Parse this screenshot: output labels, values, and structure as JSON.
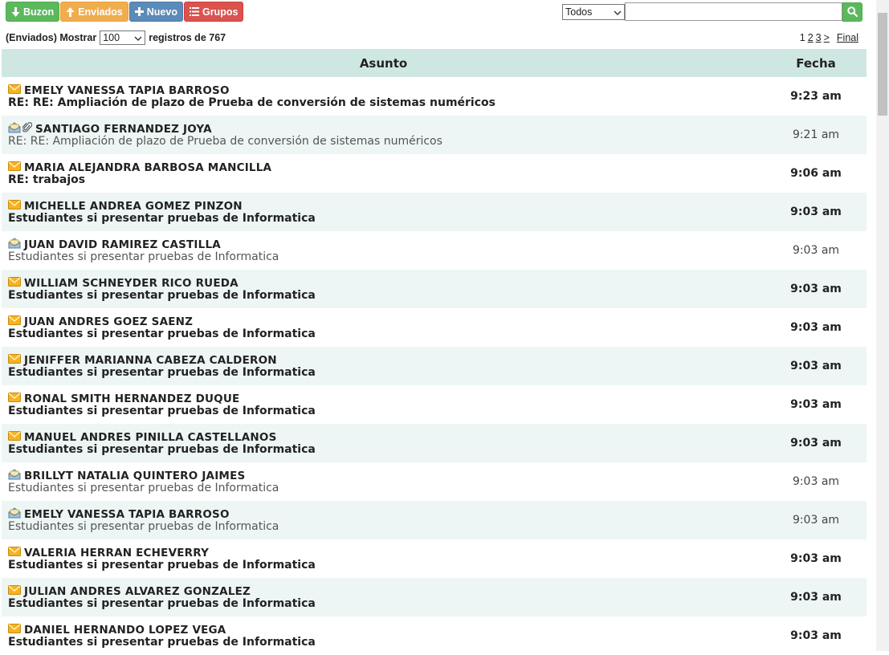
{
  "toolbar": {
    "buzon_label": "Buzon",
    "enviados_label": "Enviados",
    "nuevo_label": "Nuevo",
    "grupos_label": "Grupos"
  },
  "search": {
    "filter_value": "Todos",
    "query": ""
  },
  "listing": {
    "prefix": "(Enviados) Mostrar",
    "per_page": "100",
    "suffix": "registros de 767"
  },
  "pagination": {
    "pages": [
      "1",
      "2",
      "3",
      ">"
    ],
    "final_label": "Final"
  },
  "table": {
    "col_asunto": "Asunto",
    "col_fecha": "Fecha"
  },
  "messages": [
    {
      "name": "EMELY VANESSA TAPIA BARROSO",
      "subject": "RE: RE: Ampliación de plazo de Prueba de conversión de sistemas numéricos",
      "time": "9:23 am",
      "status": "unread",
      "icon": "envelope-icon",
      "attachment": false
    },
    {
      "name": "SANTIAGO FERNANDEZ JOYA",
      "subject": "RE: RE: Ampliación de plazo de Prueba de conversión de sistemas numéricos",
      "time": "9:21 am",
      "status": "read",
      "icon": "open-envelope-icon",
      "attachment": true
    },
    {
      "name": "MARIA ALEJANDRA BARBOSA MANCILLA",
      "subject": "RE: trabajos",
      "time": "9:06 am",
      "status": "unread",
      "icon": "envelope-icon",
      "attachment": false
    },
    {
      "name": "MICHELLE ANDREA GOMEZ PINZON",
      "subject": "Estudiantes si presentar pruebas de Informatica",
      "time": "9:03 am",
      "status": "unread",
      "icon": "envelope-icon",
      "attachment": false
    },
    {
      "name": "JUAN DAVID RAMIREZ CASTILLA",
      "subject": "Estudiantes si presentar pruebas de Informatica",
      "time": "9:03 am",
      "status": "read",
      "icon": "open-envelope-icon",
      "attachment": false
    },
    {
      "name": "WILLIAM SCHNEYDER RICO RUEDA",
      "subject": "Estudiantes si presentar pruebas de Informatica",
      "time": "9:03 am",
      "status": "unread",
      "icon": "envelope-icon",
      "attachment": false
    },
    {
      "name": "JUAN ANDRES GOEZ SAENZ",
      "subject": "Estudiantes si presentar pruebas de Informatica",
      "time": "9:03 am",
      "status": "unread",
      "icon": "envelope-icon",
      "attachment": false
    },
    {
      "name": "JENIFFER MARIANNA CABEZA CALDERON",
      "subject": "Estudiantes si presentar pruebas de Informatica",
      "time": "9:03 am",
      "status": "unread",
      "icon": "envelope-icon",
      "attachment": false
    },
    {
      "name": "RONAL SMITH HERNANDEZ DUQUE",
      "subject": "Estudiantes si presentar pruebas de Informatica",
      "time": "9:03 am",
      "status": "unread",
      "icon": "envelope-icon",
      "attachment": false
    },
    {
      "name": "MANUEL ANDRES PINILLA CASTELLANOS",
      "subject": "Estudiantes si presentar pruebas de Informatica",
      "time": "9:03 am",
      "status": "unread",
      "icon": "envelope-icon",
      "attachment": false
    },
    {
      "name": "BRILLYT NATALIA QUINTERO JAIMES",
      "subject": "Estudiantes si presentar pruebas de Informatica",
      "time": "9:03 am",
      "status": "read",
      "icon": "open-envelope-icon",
      "attachment": false
    },
    {
      "name": "EMELY VANESSA TAPIA BARROSO",
      "subject": "Estudiantes si presentar pruebas de Informatica",
      "time": "9:03 am",
      "status": "read",
      "icon": "open-envelope-icon",
      "attachment": false
    },
    {
      "name": "VALERIA HERRAN ECHEVERRY",
      "subject": "Estudiantes si presentar pruebas de Informatica",
      "time": "9:03 am",
      "status": "unread",
      "icon": "envelope-icon",
      "attachment": false
    },
    {
      "name": "JULIAN ANDRES ALVAREZ GONZALEZ",
      "subject": "Estudiantes si presentar pruebas de Informatica",
      "time": "9:03 am",
      "status": "unread",
      "icon": "envelope-icon",
      "attachment": false
    },
    {
      "name": "DANIEL HERNANDO LOPEZ VEGA",
      "subject": "Estudiantes si presentar pruebas de Informatica",
      "time": "9:03 am",
      "status": "unread",
      "icon": "envelope-icon",
      "attachment": false
    }
  ],
  "colors": {
    "header_bg": "#cfe7e3",
    "alt_row_bg": "#edf6f4",
    "btn_green": "#5cb85c",
    "btn_orange": "#f0ad4e",
    "btn_blue": "#5b8bb8",
    "btn_red": "#d9534f"
  }
}
